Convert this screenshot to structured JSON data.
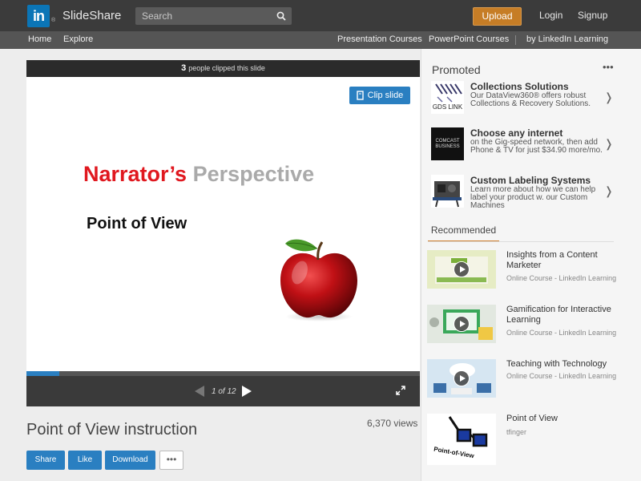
{
  "header": {
    "logo_text": "SlideShare",
    "logo_mark": "in",
    "logo_reg": "®",
    "search_placeholder": "Search",
    "upload_label": "Upload",
    "login_label": "Login",
    "signup_label": "Signup"
  },
  "subnav": {
    "home": "Home",
    "explore": "Explore",
    "presentation_courses": "Presentation Courses",
    "powerpoint_courses": "PowerPoint Courses",
    "by_linkedin": "by LinkedIn Learning"
  },
  "player": {
    "clip_count": "3",
    "clip_text": "people clipped this slide",
    "clip_button": "Clip slide",
    "slide_title_part1": "Narrator’s",
    "slide_title_part2": "Perspective",
    "slide_subtitle": "Point of View",
    "page_indicator": "1 of 12",
    "progress_fraction": 0.083
  },
  "document": {
    "title": "Point of View instruction",
    "views": "6,370 views",
    "share_label": "Share",
    "like_label": "Like",
    "download_label": "Download",
    "more_label": "•••"
  },
  "promoted": {
    "title": "Promoted",
    "more": "•••",
    "ads": [
      {
        "title": "Collections Solutions",
        "desc": "Our DataView360® offers robust Collections & Recovery Solutions.",
        "thumb_text": "GDS LINK"
      },
      {
        "title": "Choose any internet",
        "desc": "on the Gig-speed network, then add Phone & TV for just $34.90 more/mo.",
        "thumb_text": "COMCAST BUSINESS"
      },
      {
        "title": "Custom Labeling Systems",
        "desc": "Learn more about how we can help label your product w. our Custom Machines",
        "thumb_text": ""
      }
    ],
    "chevron": "❭"
  },
  "recommended": {
    "tab_label": "Recommended",
    "items": [
      {
        "title": "Insights from a Content Marketer",
        "meta": "Online Course - LinkedIn Learning"
      },
      {
        "title": "Gamification for Interactive Learning",
        "meta": "Online Course - LinkedIn Learning"
      },
      {
        "title": "Teaching with Technology",
        "meta": "Online Course - LinkedIn Learning"
      },
      {
        "title": "Point of View",
        "meta": "tfinger",
        "thumb_text": "Point-of-View"
      }
    ]
  },
  "colors": {
    "accent_blue": "#2a7fc1",
    "upload_orange": "#c67d26",
    "title_red": "#e0181f"
  }
}
